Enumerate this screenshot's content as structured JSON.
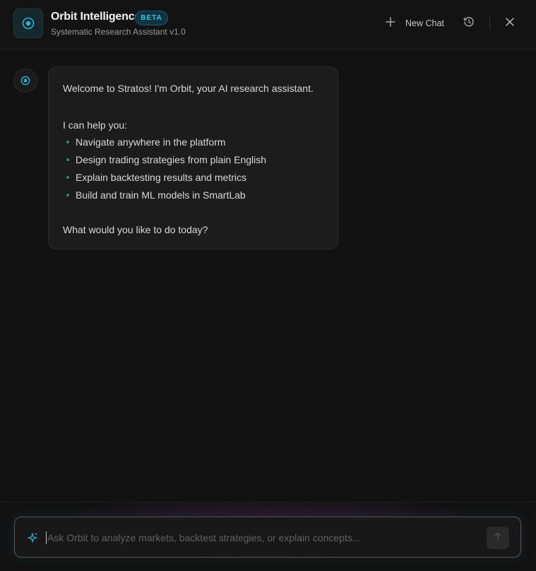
{
  "header": {
    "title": "Orbit Intelligence",
    "badge": "BETA",
    "subtitle": "Systematic Research Assistant v1.0",
    "new_chat_label": "New Chat",
    "icons": {
      "logo": "orbit-logo-icon",
      "new_chat": "plus-icon",
      "history": "history-icon",
      "close": "close-icon"
    }
  },
  "message": {
    "greeting": "Welcome to Stratos! I'm Orbit, your AI research assistant.",
    "intro": "I can help you:",
    "items": [
      "Navigate anywhere in the platform",
      "Design trading strategies from plain English",
      "Explain backtesting results and metrics",
      "Build and train ML models in SmartLab"
    ],
    "closing": "What would you like to do today?"
  },
  "composer": {
    "placeholder": "Ask Orbit to analyze markets, backtest strategies, or explain concepts...",
    "value": "",
    "icons": {
      "left": "sparkle-icon",
      "send": "send-arrow-icon"
    }
  },
  "colors": {
    "accent": "#2ec6e6",
    "background": "#121212",
    "bubble": "#1c1c1c",
    "bullet": "#1f8f7a"
  }
}
